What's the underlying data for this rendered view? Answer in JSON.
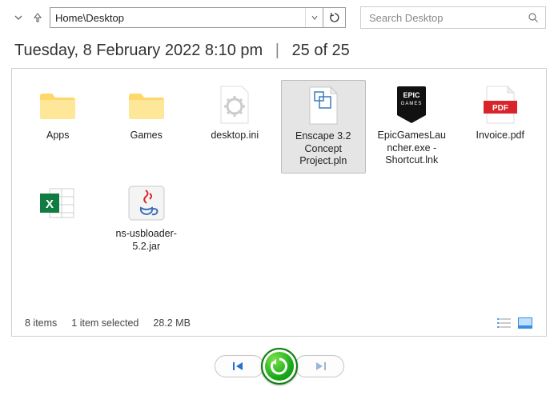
{
  "address_bar": "Home\\Desktop",
  "search": {
    "placeholder": "Search Desktop"
  },
  "timestamp": "Tuesday, 8 February 2022 8:10 pm",
  "position_pipe": "|",
  "position": "25 of 25",
  "status": {
    "items": "8 items",
    "selected": "1 item selected",
    "size": "28.2 MB"
  },
  "files": [
    {
      "name": "Apps",
      "icon": "folder",
      "selected": false
    },
    {
      "name": "Games",
      "icon": "folder",
      "selected": false
    },
    {
      "name": "desktop.ini",
      "icon": "ini",
      "selected": false
    },
    {
      "name": "Enscape 3.2 Concept Project.pln",
      "icon": "pln",
      "selected": true
    },
    {
      "name": "EpicGamesLauncher.exe - Shortcut.lnk",
      "icon": "epic",
      "selected": false
    },
    {
      "name": "Invoice.pdf",
      "icon": "pdf",
      "selected": false
    },
    {
      "name": "",
      "icon": "excel",
      "selected": false
    },
    {
      "name": "ns-usbloader-5.2.jar",
      "icon": "jar",
      "selected": false
    }
  ]
}
